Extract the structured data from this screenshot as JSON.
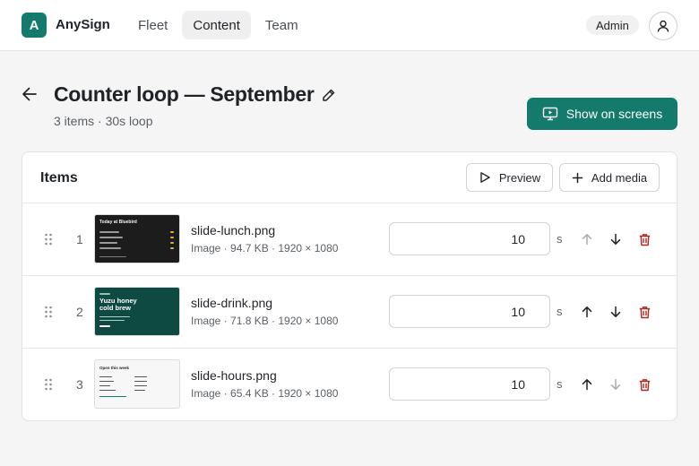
{
  "app": {
    "logo_letter": "A",
    "name": "AnySign"
  },
  "nav": [
    {
      "label": "Fleet",
      "active": false
    },
    {
      "label": "Content",
      "active": true
    },
    {
      "label": "Team",
      "active": false
    }
  ],
  "user": {
    "role": "Admin",
    "avatar_icon": "user-icon"
  },
  "page": {
    "title": "Counter loop — September",
    "subtitle": "3 items · 30s loop",
    "show_button": "Show on screens"
  },
  "items_panel": {
    "title": "Items",
    "preview_button": "Preview",
    "add_button": "Add media",
    "unit": "s",
    "rows": [
      {
        "index": "1",
        "filename": "slide-lunch.png",
        "meta": "Image · 94.7 KB · 1920 × 1080",
        "duration": "10",
        "thumb_heading": "Today at Bluebird",
        "up_enabled": false,
        "down_enabled": true
      },
      {
        "index": "2",
        "filename": "slide-drink.png",
        "meta": "Image · 71.8 KB · 1920 × 1080",
        "duration": "10",
        "thumb_heading": "Yuzu honey cold brew",
        "up_enabled": true,
        "down_enabled": true
      },
      {
        "index": "3",
        "filename": "slide-hours.png",
        "meta": "Image · 65.4 KB · 1920 × 1080",
        "duration": "10",
        "thumb_heading": "Open this week",
        "up_enabled": true,
        "down_enabled": false
      }
    ]
  },
  "colors": {
    "accent": "#137a6c",
    "danger": "#b3261e",
    "disabled": "#a9adb2"
  }
}
